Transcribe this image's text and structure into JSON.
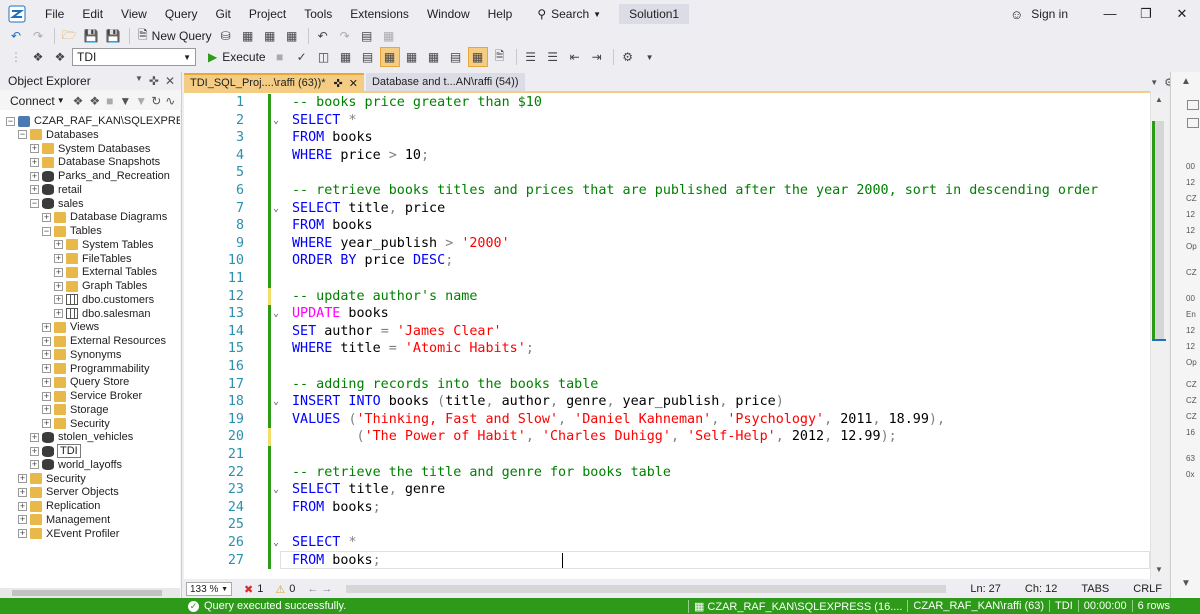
{
  "menubar": {
    "items": [
      "File",
      "Edit",
      "View",
      "Query",
      "Git",
      "Project",
      "Tools",
      "Extensions",
      "Window",
      "Help"
    ],
    "search_label": "Search",
    "solution": "Solution1",
    "signin": "Sign in"
  },
  "toolbar": {
    "new_query_label": "New Query",
    "database": "TDI",
    "execute_label": "Execute"
  },
  "object_explorer": {
    "title": "Object Explorer",
    "connect_label": "Connect",
    "tree": [
      {
        "label": "CZAR_RAF_KAN\\SQLEXPRESS (SQL",
        "indent": 0,
        "expander": "-",
        "icon": "server"
      },
      {
        "label": "Databases",
        "indent": 1,
        "expander": "-",
        "icon": "folder"
      },
      {
        "label": "System Databases",
        "indent": 2,
        "expander": "+",
        "icon": "folder"
      },
      {
        "label": "Database Snapshots",
        "indent": 2,
        "expander": "+",
        "icon": "folder"
      },
      {
        "label": "Parks_and_Recreation",
        "indent": 2,
        "expander": "+",
        "icon": "db"
      },
      {
        "label": "retail",
        "indent": 2,
        "expander": "+",
        "icon": "db"
      },
      {
        "label": "sales",
        "indent": 2,
        "expander": "-",
        "icon": "db"
      },
      {
        "label": "Database Diagrams",
        "indent": 3,
        "expander": "+",
        "icon": "folder"
      },
      {
        "label": "Tables",
        "indent": 3,
        "expander": "-",
        "icon": "folder"
      },
      {
        "label": "System Tables",
        "indent": 4,
        "expander": "+",
        "icon": "folder"
      },
      {
        "label": "FileTables",
        "indent": 4,
        "expander": "+",
        "icon": "folder"
      },
      {
        "label": "External Tables",
        "indent": 4,
        "expander": "+",
        "icon": "folder"
      },
      {
        "label": "Graph Tables",
        "indent": 4,
        "expander": "+",
        "icon": "folder"
      },
      {
        "label": "dbo.customers",
        "indent": 4,
        "expander": "+",
        "icon": "table"
      },
      {
        "label": "dbo.salesman",
        "indent": 4,
        "expander": "+",
        "icon": "table"
      },
      {
        "label": "Views",
        "indent": 3,
        "expander": "+",
        "icon": "folder"
      },
      {
        "label": "External Resources",
        "indent": 3,
        "expander": "+",
        "icon": "folder"
      },
      {
        "label": "Synonyms",
        "indent": 3,
        "expander": "+",
        "icon": "folder"
      },
      {
        "label": "Programmability",
        "indent": 3,
        "expander": "+",
        "icon": "folder"
      },
      {
        "label": "Query Store",
        "indent": 3,
        "expander": "+",
        "icon": "folder"
      },
      {
        "label": "Service Broker",
        "indent": 3,
        "expander": "+",
        "icon": "folder"
      },
      {
        "label": "Storage",
        "indent": 3,
        "expander": "+",
        "icon": "folder"
      },
      {
        "label": "Security",
        "indent": 3,
        "expander": "+",
        "icon": "folder"
      },
      {
        "label": "stolen_vehicles",
        "indent": 2,
        "expander": "+",
        "icon": "db"
      },
      {
        "label": "TDI",
        "indent": 2,
        "expander": "+",
        "icon": "db",
        "selected": true
      },
      {
        "label": "world_layoffs",
        "indent": 2,
        "expander": "+",
        "icon": "db"
      },
      {
        "label": "Security",
        "indent": 1,
        "expander": "+",
        "icon": "folder"
      },
      {
        "label": "Server Objects",
        "indent": 1,
        "expander": "+",
        "icon": "folder"
      },
      {
        "label": "Replication",
        "indent": 1,
        "expander": "+",
        "icon": "folder"
      },
      {
        "label": "Management",
        "indent": 1,
        "expander": "+",
        "icon": "folder"
      },
      {
        "label": "XEvent Profiler",
        "indent": 1,
        "expander": "+",
        "icon": "folder"
      }
    ]
  },
  "tabs": {
    "active": "TDI_SQL_Proj....\\raffi (63))*",
    "inactive": "Database and t...AN\\raffi (54))"
  },
  "editor": {
    "lines": [
      {
        "n": "1",
        "tokens": [
          [
            "cm",
            "-- books price greater than $10"
          ]
        ],
        "track": "green",
        "fold": ""
      },
      {
        "n": "2",
        "tokens": [
          [
            "kw",
            "SELECT"
          ],
          [
            "pl",
            " "
          ],
          [
            "gr",
            "*"
          ]
        ],
        "track": "green",
        "fold": "v"
      },
      {
        "n": "3",
        "tokens": [
          [
            "kw",
            "FROM"
          ],
          [
            "pl",
            " books"
          ]
        ],
        "track": "green",
        "fold": ""
      },
      {
        "n": "4",
        "tokens": [
          [
            "kw",
            "WHERE"
          ],
          [
            "pl",
            " price "
          ],
          [
            "gr",
            ">"
          ],
          [
            "pl",
            " 10"
          ],
          [
            "gr",
            ";"
          ]
        ],
        "track": "green",
        "fold": ""
      },
      {
        "n": "5",
        "tokens": [],
        "track": "green",
        "fold": ""
      },
      {
        "n": "6",
        "tokens": [
          [
            "cm",
            "-- retrieve books titles and prices that are published after the year 2000, sort in descending order"
          ]
        ],
        "track": "green",
        "fold": ""
      },
      {
        "n": "7",
        "tokens": [
          [
            "kw",
            "SELECT"
          ],
          [
            "pl",
            " title"
          ],
          [
            "gr",
            ","
          ],
          [
            "pl",
            " price"
          ]
        ],
        "track": "green",
        "fold": "v"
      },
      {
        "n": "8",
        "tokens": [
          [
            "kw",
            "FROM"
          ],
          [
            "pl",
            " books"
          ]
        ],
        "track": "green",
        "fold": ""
      },
      {
        "n": "9",
        "tokens": [
          [
            "kw",
            "WHERE"
          ],
          [
            "pl",
            " year_publish "
          ],
          [
            "gr",
            ">"
          ],
          [
            "pl",
            " "
          ],
          [
            "str",
            "'2000'"
          ]
        ],
        "track": "green",
        "fold": ""
      },
      {
        "n": "10",
        "tokens": [
          [
            "kw",
            "ORDER BY"
          ],
          [
            "pl",
            " price "
          ],
          [
            "kw",
            "DESC"
          ],
          [
            "gr",
            ";"
          ]
        ],
        "track": "green",
        "fold": ""
      },
      {
        "n": "11",
        "tokens": [],
        "track": "green",
        "fold": ""
      },
      {
        "n": "12",
        "tokens": [
          [
            "cm",
            "-- update author's name"
          ]
        ],
        "track": "yellow",
        "fold": ""
      },
      {
        "n": "13",
        "tokens": [
          [
            "kw2",
            "UPDATE"
          ],
          [
            "pl",
            " books"
          ]
        ],
        "track": "green",
        "fold": "v"
      },
      {
        "n": "14",
        "tokens": [
          [
            "kw",
            "SET"
          ],
          [
            "pl",
            " author "
          ],
          [
            "gr",
            "="
          ],
          [
            "pl",
            " "
          ],
          [
            "str",
            "'James Clear'"
          ]
        ],
        "track": "green",
        "fold": ""
      },
      {
        "n": "15",
        "tokens": [
          [
            "kw",
            "WHERE"
          ],
          [
            "pl",
            " title "
          ],
          [
            "gr",
            "="
          ],
          [
            "pl",
            " "
          ],
          [
            "str",
            "'Atomic Habits'"
          ],
          [
            "gr",
            ";"
          ]
        ],
        "track": "green",
        "fold": ""
      },
      {
        "n": "16",
        "tokens": [],
        "track": "green",
        "fold": ""
      },
      {
        "n": "17",
        "tokens": [
          [
            "cm",
            "-- adding records into the books table"
          ]
        ],
        "track": "green",
        "fold": ""
      },
      {
        "n": "18",
        "tokens": [
          [
            "kw",
            "INSERT INTO"
          ],
          [
            "pl",
            " books "
          ],
          [
            "gr",
            "("
          ],
          [
            "pl",
            "title"
          ],
          [
            "gr",
            ","
          ],
          [
            "pl",
            " author"
          ],
          [
            "gr",
            ","
          ],
          [
            "pl",
            " genre"
          ],
          [
            "gr",
            ","
          ],
          [
            "pl",
            " year_publish"
          ],
          [
            "gr",
            ","
          ],
          [
            "pl",
            " price"
          ],
          [
            "gr",
            ")"
          ]
        ],
        "track": "green",
        "fold": "v"
      },
      {
        "n": "19",
        "tokens": [
          [
            "kw",
            "VALUES"
          ],
          [
            "pl",
            " "
          ],
          [
            "gr",
            "("
          ],
          [
            "str",
            "'Thinking, Fast and Slow'"
          ],
          [
            "gr",
            ","
          ],
          [
            "pl",
            " "
          ],
          [
            "str",
            "'Daniel Kahneman'"
          ],
          [
            "gr",
            ","
          ],
          [
            "pl",
            " "
          ],
          [
            "str",
            "'Psychology'"
          ],
          [
            "gr",
            ","
          ],
          [
            "pl",
            " 2011"
          ],
          [
            "gr",
            ","
          ],
          [
            "pl",
            " 18.99"
          ],
          [
            "gr",
            "),"
          ]
        ],
        "track": "green",
        "fold": ""
      },
      {
        "n": "20",
        "tokens": [
          [
            "pl",
            "        "
          ],
          [
            "gr",
            "("
          ],
          [
            "str",
            "'The Power of Habit'"
          ],
          [
            "gr",
            ","
          ],
          [
            "pl",
            " "
          ],
          [
            "str",
            "'Charles Duhigg'"
          ],
          [
            "gr",
            ","
          ],
          [
            "pl",
            " "
          ],
          [
            "str",
            "'Self-Help'"
          ],
          [
            "gr",
            ","
          ],
          [
            "pl",
            " 2012"
          ],
          [
            "gr",
            ","
          ],
          [
            "pl",
            " 12.99"
          ],
          [
            "gr",
            ");"
          ]
        ],
        "track": "yellow",
        "fold": ""
      },
      {
        "n": "21",
        "tokens": [],
        "track": "green",
        "fold": ""
      },
      {
        "n": "22",
        "tokens": [
          [
            "cm",
            "-- retrieve the title and genre for books table"
          ]
        ],
        "track": "green",
        "fold": ""
      },
      {
        "n": "23",
        "tokens": [
          [
            "kw",
            "SELECT"
          ],
          [
            "pl",
            " title"
          ],
          [
            "gr",
            ","
          ],
          [
            "pl",
            " genre"
          ]
        ],
        "track": "green",
        "fold": "v"
      },
      {
        "n": "24",
        "tokens": [
          [
            "kw",
            "FROM"
          ],
          [
            "pl",
            " books"
          ],
          [
            "gr",
            ";"
          ]
        ],
        "track": "green",
        "fold": ""
      },
      {
        "n": "25",
        "tokens": [],
        "track": "green",
        "fold": ""
      },
      {
        "n": "26",
        "tokens": [
          [
            "kw",
            "SELECT"
          ],
          [
            "pl",
            " "
          ],
          [
            "gr",
            "*"
          ]
        ],
        "track": "green",
        "fold": "v"
      },
      {
        "n": "27",
        "tokens": [
          [
            "kw",
            "FROM"
          ],
          [
            "pl",
            " books"
          ],
          [
            "gr",
            ";"
          ]
        ],
        "track": "green",
        "fold": ""
      }
    ]
  },
  "right_panel": {
    "snippets": [
      "00",
      "12",
      "CZ",
      "12",
      "12",
      "Op",
      "CZ",
      "00",
      "En",
      "12",
      "12",
      "Op",
      "CZ",
      "CZ",
      "CZ",
      "16",
      "63",
      "0x",
      "Co",
      "The",
      "e..."
    ]
  },
  "editor_footer": {
    "zoom": "133 %",
    "errors": "1",
    "warnings": "0",
    "ln": "Ln: 27",
    "ch": "Ch: 12",
    "tabs": "TABS",
    "crlf": "CRLF"
  },
  "statusbar": {
    "message": "Query executed successfully.",
    "server": "CZAR_RAF_KAN\\SQLEXPRESS (16....",
    "user": "CZAR_RAF_KAN\\raffi (63)",
    "db": "TDI",
    "time": "00:00:00",
    "rows": "6 rows"
  },
  "colors": {
    "accent_tab": "#f5cc84",
    "status_green": "#2e9a1a",
    "keyword": "#0000ff",
    "string": "#ff0000",
    "comment": "#008000",
    "update_keyword": "#ff00ff"
  }
}
